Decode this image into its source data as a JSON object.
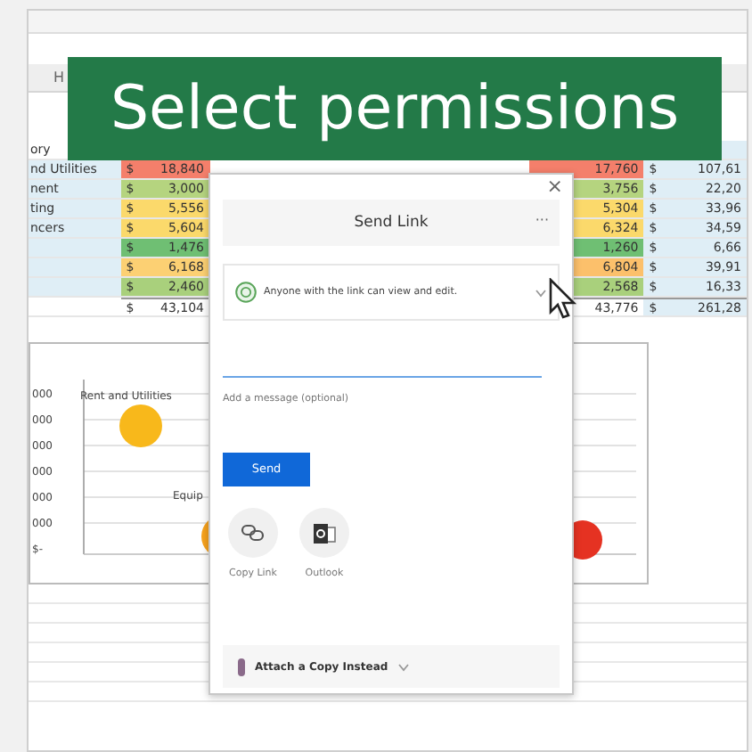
{
  "caption": "Select permissions",
  "sheet": {
    "column_header": "H",
    "rows": [
      {
        "kind": "header",
        "label": "ory"
      },
      {
        "kind": "data",
        "label": "nd Utilities",
        "col_b": {
          "currency": "$",
          "value": "18,840",
          "color": "#f47f6b"
        },
        "col_c": {
          "value": "17,760",
          "color": "#f47f6b"
        },
        "col_d": {
          "currency": "$",
          "value": "107,61"
        }
      },
      {
        "kind": "data",
        "label": "nent",
        "col_b": {
          "currency": "$",
          "value": "3,000",
          "color": "#b5d47f"
        },
        "col_c": {
          "value": "3,756",
          "color": "#b5d47f"
        },
        "col_d": {
          "currency": "$",
          "value": "22,20"
        }
      },
      {
        "kind": "data",
        "label": "ting",
        "col_b": {
          "currency": "$",
          "value": "5,556",
          "color": "#fbd96b"
        },
        "col_c": {
          "value": "5,304",
          "color": "#fbd96b"
        },
        "col_d": {
          "currency": "$",
          "value": "33,96"
        }
      },
      {
        "kind": "data",
        "label": "ncers",
        "col_b": {
          "currency": "$",
          "value": "5,604",
          "color": "#fbd96b"
        },
        "col_c": {
          "value": "6,324",
          "color": "#fbd96b"
        },
        "col_d": {
          "currency": "$",
          "value": "34,59"
        }
      },
      {
        "kind": "data",
        "label": "",
        "col_b": {
          "currency": "$",
          "value": "1,476",
          "color": "#6fbf73"
        },
        "col_c": {
          "value": "1,260",
          "color": "#6fbf73"
        },
        "col_d": {
          "currency": "$",
          "value": "6,66"
        }
      },
      {
        "kind": "data",
        "label": "",
        "col_b": {
          "currency": "$",
          "value": "6,168",
          "color": "#fcd073"
        },
        "col_c": {
          "value": "6,804",
          "color": "#fcc06b"
        },
        "col_d": {
          "currency": "$",
          "value": "39,91"
        }
      },
      {
        "kind": "data",
        "label": "",
        "col_b": {
          "currency": "$",
          "value": "2,460",
          "color": "#a9d07c"
        },
        "col_c": {
          "value": "2,568",
          "color": "#a9d07c"
        },
        "col_d": {
          "currency": "$",
          "value": "16,33"
        }
      },
      {
        "kind": "total",
        "label": "",
        "col_b": {
          "currency": "$",
          "value": "43,104"
        },
        "col_c": {
          "value": "43,776"
        },
        "col_d": {
          "currency": "$",
          "value": "261,28"
        }
      }
    ]
  },
  "chart": {
    "y_labels": [
      "000",
      "000",
      "000",
      "000",
      "000",
      "000",
      "$-"
    ],
    "bubble_labels": [
      "Rent and Utilities",
      "Equip"
    ]
  },
  "dialog": {
    "title": "Send Link",
    "more": "···",
    "close": "×",
    "permission": "Anyone with the link can view and edit.",
    "message_placeholder": "Add a message (optional)",
    "send": "Send",
    "share_options": [
      {
        "kind": "link",
        "label": "Copy Link"
      },
      {
        "kind": "outlook",
        "label": "Outlook"
      }
    ],
    "footer": "Attach a Copy Instead"
  }
}
